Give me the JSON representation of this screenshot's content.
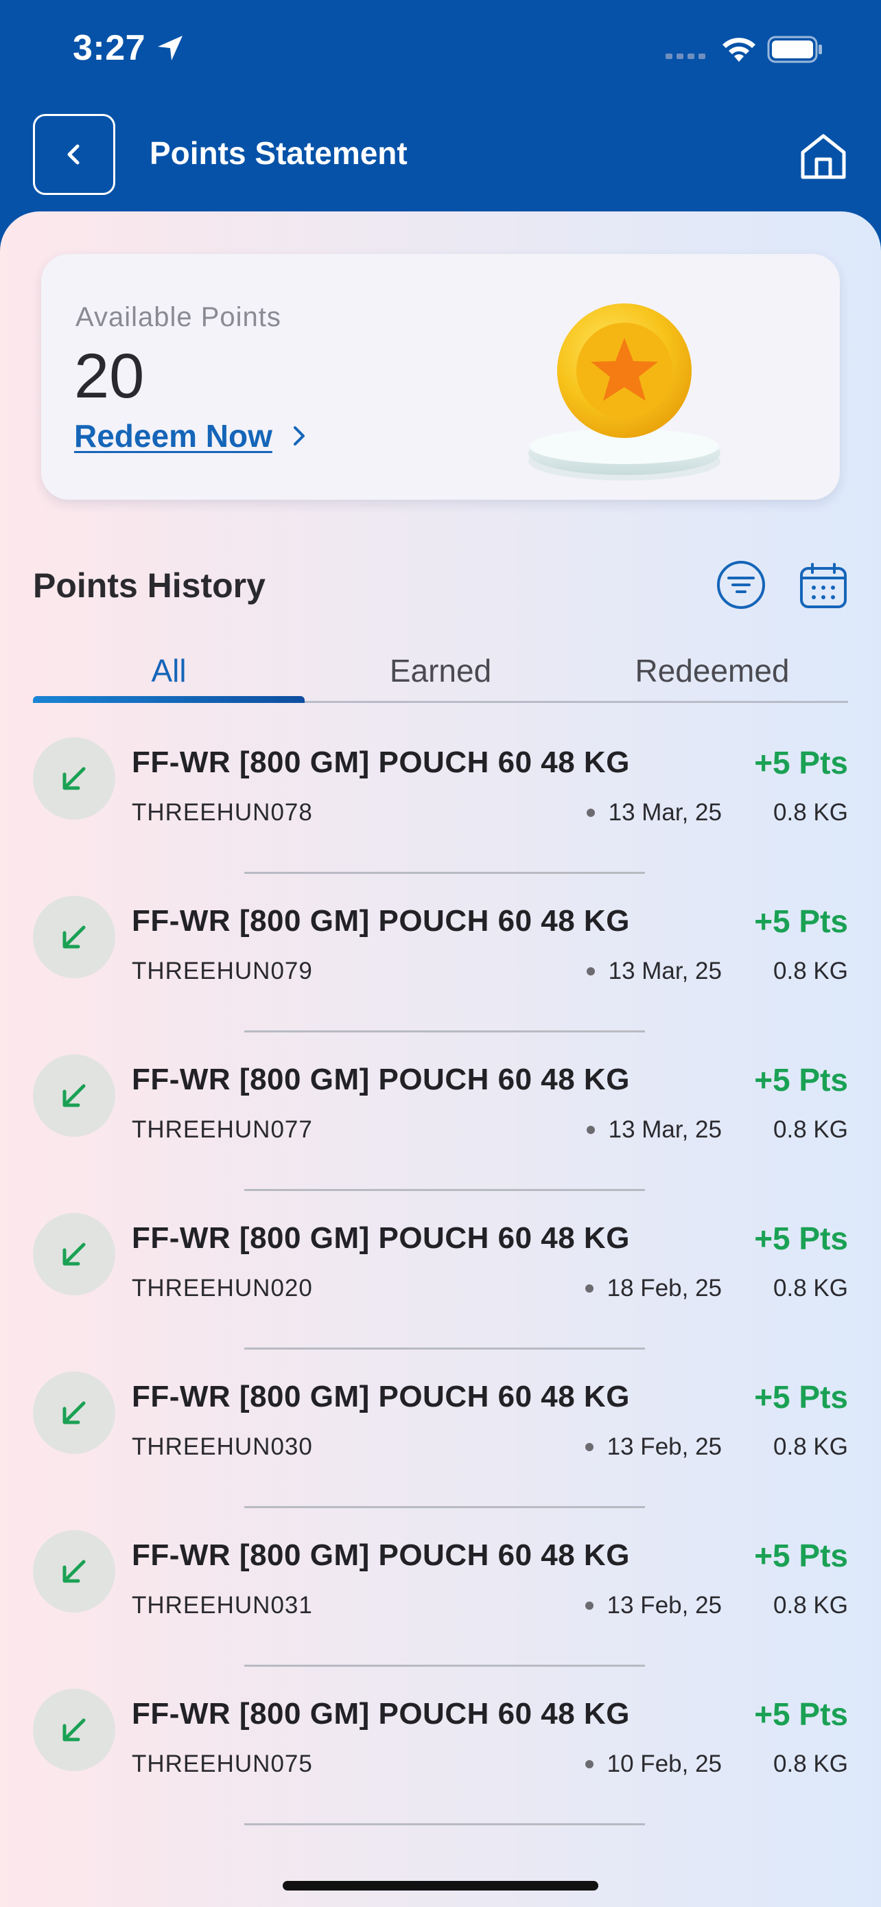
{
  "status_bar": {
    "time": "3:27"
  },
  "header": {
    "title": "Points Statement"
  },
  "points_card": {
    "label": "Available Points",
    "value": "20",
    "redeem_label": "Redeem Now"
  },
  "history": {
    "title": "Points History",
    "tabs": [
      {
        "label": "All",
        "active": true
      },
      {
        "label": "Earned",
        "active": false
      },
      {
        "label": "Redeemed",
        "active": false
      }
    ],
    "transactions": [
      {
        "title": "FF-WR [800 GM] POUCH 60 48 KG",
        "points": "+5 Pts",
        "code": "THREEHUN078",
        "date": "13 Mar, 25",
        "weight": "0.8 KG"
      },
      {
        "title": "FF-WR [800 GM] POUCH 60 48 KG",
        "points": "+5 Pts",
        "code": "THREEHUN079",
        "date": "13 Mar, 25",
        "weight": "0.8 KG"
      },
      {
        "title": "FF-WR [800 GM] POUCH 60 48 KG",
        "points": "+5 Pts",
        "code": "THREEHUN077",
        "date": "13 Mar, 25",
        "weight": "0.8 KG"
      },
      {
        "title": "FF-WR [800 GM] POUCH 60 48 KG",
        "points": "+5 Pts",
        "code": "THREEHUN020",
        "date": "18 Feb, 25",
        "weight": "0.8 KG"
      },
      {
        "title": "FF-WR [800 GM] POUCH 60 48 KG",
        "points": "+5 Pts",
        "code": "THREEHUN030",
        "date": "13 Feb, 25",
        "weight": "0.8 KG"
      },
      {
        "title": "FF-WR [800 GM] POUCH 60 48 KG",
        "points": "+5 Pts",
        "code": "THREEHUN031",
        "date": "13 Feb, 25",
        "weight": "0.8 KG"
      },
      {
        "title": "FF-WR [800 GM] POUCH 60 48 KG",
        "points": "+5 Pts",
        "code": "THREEHUN075",
        "date": "10 Feb, 25",
        "weight": "0.8 KG"
      }
    ]
  },
  "colors": {
    "header_bg": "#0652A8",
    "accent_blue": "#1565B8",
    "earned_green": "#1aa154"
  },
  "icons": {
    "back": "chevron-left-icon",
    "home": "home-icon",
    "filter": "filter-icon",
    "calendar": "calendar-icon",
    "earned": "arrow-down-left-icon",
    "coin": "star-coin-icon"
  }
}
